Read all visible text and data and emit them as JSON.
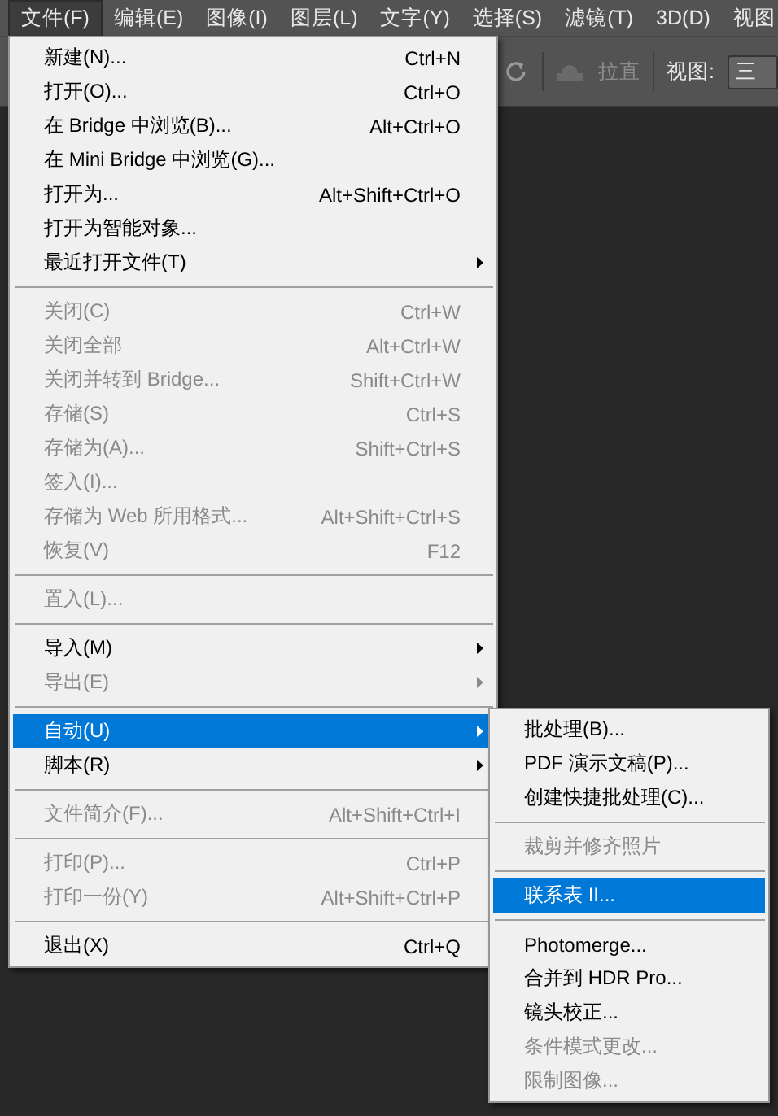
{
  "menu_bar": [
    {
      "label": "文件(F)",
      "selected": true
    },
    {
      "label": "编辑(E)",
      "selected": false
    },
    {
      "label": "图像(I)",
      "selected": false
    },
    {
      "label": "图层(L)",
      "selected": false
    },
    {
      "label": "文字(Y)",
      "selected": false
    },
    {
      "label": "选择(S)",
      "selected": false
    },
    {
      "label": "滤镜(T)",
      "selected": false
    },
    {
      "label": "3D(D)",
      "selected": false
    },
    {
      "label": "视图",
      "selected": false
    }
  ],
  "options_bar": {
    "straighten_label": "拉直",
    "view_label": "视图:",
    "view_value": "三"
  },
  "file_menu": [
    {
      "kind": "item",
      "label": "新建(N)...",
      "shortcut": "Ctrl+N",
      "disabled": false,
      "submenu": false,
      "selected": false
    },
    {
      "kind": "item",
      "label": "打开(O)...",
      "shortcut": "Ctrl+O",
      "disabled": false,
      "submenu": false,
      "selected": false
    },
    {
      "kind": "item",
      "label": "在 Bridge 中浏览(B)...",
      "shortcut": "Alt+Ctrl+O",
      "disabled": false,
      "submenu": false,
      "selected": false
    },
    {
      "kind": "item",
      "label": "在 Mini Bridge 中浏览(G)...",
      "disabled": false,
      "submenu": false,
      "selected": false
    },
    {
      "kind": "item",
      "label": "打开为...",
      "shortcut": "Alt+Shift+Ctrl+O",
      "disabled": false,
      "submenu": false,
      "selected": false
    },
    {
      "kind": "item",
      "label": "打开为智能对象...",
      "disabled": false,
      "submenu": false,
      "selected": false
    },
    {
      "kind": "item",
      "label": "最近打开文件(T)",
      "disabled": false,
      "submenu": true,
      "selected": false
    },
    {
      "kind": "separator"
    },
    {
      "kind": "item",
      "label": "关闭(C)",
      "shortcut": "Ctrl+W",
      "disabled": true,
      "submenu": false,
      "selected": false
    },
    {
      "kind": "item",
      "label": "关闭全部",
      "shortcut": "Alt+Ctrl+W",
      "disabled": true,
      "submenu": false,
      "selected": false
    },
    {
      "kind": "item",
      "label": "关闭并转到 Bridge...",
      "shortcut": "Shift+Ctrl+W",
      "disabled": true,
      "submenu": false,
      "selected": false
    },
    {
      "kind": "item",
      "label": "存储(S)",
      "shortcut": "Ctrl+S",
      "disabled": true,
      "submenu": false,
      "selected": false
    },
    {
      "kind": "item",
      "label": "存储为(A)...",
      "shortcut": "Shift+Ctrl+S",
      "disabled": true,
      "submenu": false,
      "selected": false
    },
    {
      "kind": "item",
      "label": "签入(I)...",
      "disabled": true,
      "submenu": false,
      "selected": false
    },
    {
      "kind": "item",
      "label": "存储为 Web 所用格式...",
      "shortcut": "Alt+Shift+Ctrl+S",
      "disabled": true,
      "submenu": false,
      "selected": false
    },
    {
      "kind": "item",
      "label": "恢复(V)",
      "shortcut": "F12",
      "disabled": true,
      "submenu": false,
      "selected": false
    },
    {
      "kind": "separator"
    },
    {
      "kind": "item",
      "label": "置入(L)...",
      "disabled": true,
      "submenu": false,
      "selected": false
    },
    {
      "kind": "separator"
    },
    {
      "kind": "item",
      "label": "导入(M)",
      "disabled": false,
      "submenu": true,
      "selected": false
    },
    {
      "kind": "item",
      "label": "导出(E)",
      "disabled": true,
      "submenu": true,
      "selected": false
    },
    {
      "kind": "separator"
    },
    {
      "kind": "item",
      "label": "自动(U)",
      "disabled": false,
      "submenu": true,
      "selected": true
    },
    {
      "kind": "item",
      "label": "脚本(R)",
      "disabled": false,
      "submenu": true,
      "selected": false
    },
    {
      "kind": "separator"
    },
    {
      "kind": "item",
      "label": "文件简介(F)...",
      "shortcut": "Alt+Shift+Ctrl+I",
      "disabled": true,
      "submenu": false,
      "selected": false
    },
    {
      "kind": "separator"
    },
    {
      "kind": "item",
      "label": "打印(P)...",
      "shortcut": "Ctrl+P",
      "disabled": true,
      "submenu": false,
      "selected": false
    },
    {
      "kind": "item",
      "label": "打印一份(Y)",
      "shortcut": "Alt+Shift+Ctrl+P",
      "disabled": true,
      "submenu": false,
      "selected": false
    },
    {
      "kind": "separator"
    },
    {
      "kind": "item",
      "label": "退出(X)",
      "shortcut": "Ctrl+Q",
      "disabled": false,
      "submenu": false,
      "selected": false
    }
  ],
  "automate_submenu": [
    {
      "kind": "item",
      "label": "批处理(B)...",
      "disabled": false,
      "selected": false
    },
    {
      "kind": "item",
      "label": "PDF 演示文稿(P)...",
      "disabled": false,
      "selected": false
    },
    {
      "kind": "item",
      "label": "创建快捷批处理(C)...",
      "disabled": false,
      "selected": false
    },
    {
      "kind": "separator"
    },
    {
      "kind": "item",
      "label": "裁剪并修齐照片",
      "disabled": true,
      "selected": false
    },
    {
      "kind": "separator"
    },
    {
      "kind": "item",
      "label": "联系表 II...",
      "disabled": false,
      "selected": true
    },
    {
      "kind": "separator"
    },
    {
      "kind": "item",
      "label": "Photomerge...",
      "disabled": false,
      "selected": false
    },
    {
      "kind": "item",
      "label": "合并到 HDR Pro...",
      "disabled": false,
      "selected": false
    },
    {
      "kind": "item",
      "label": "镜头校正...",
      "disabled": false,
      "selected": false
    },
    {
      "kind": "item",
      "label": "条件模式更改...",
      "disabled": true,
      "selected": false
    },
    {
      "kind": "item",
      "label": "限制图像...",
      "disabled": true,
      "selected": false
    }
  ]
}
